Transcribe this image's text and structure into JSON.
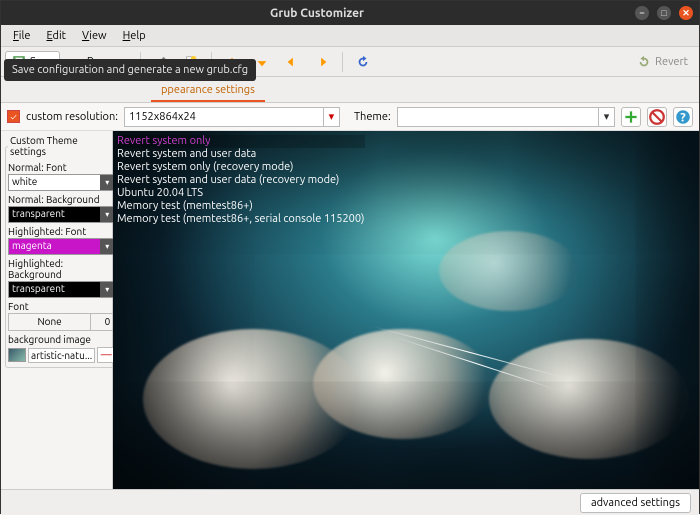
{
  "window": {
    "title": "Grub Customizer"
  },
  "menu": {
    "file": "File",
    "edit": "Edit",
    "view": "View",
    "help": "Help"
  },
  "toolbar": {
    "save": "Save",
    "remove": "Remove",
    "revert": "Revert",
    "tooltip": "Save configuration and generate a new grub.cfg"
  },
  "tabs": {
    "appearance": "ppearance settings"
  },
  "resolution": {
    "checkbox_label": "custom resolution:",
    "value": "1152x864x24",
    "theme_label": "Theme:",
    "theme_value": ""
  },
  "side": {
    "legend": "Custom Theme settings",
    "normal_font_label": "Normal: Font",
    "normal_font_value": "white",
    "normal_bg_label": "Normal: Background",
    "normal_bg_value": "transparent",
    "hl_font_label": "Highlighted: Font",
    "hl_font_value": "magenta",
    "hl_bg_label": "Highlighted: Background",
    "hl_bg_value": "transparent",
    "font_label": "Font",
    "font_name": "None",
    "font_size": "0",
    "bg_label": "background image",
    "bg_file": "artistic-natu..."
  },
  "grub": {
    "l0": "Revert system only",
    "l1": "Revert system and user data",
    "l2": "Revert system only (recovery mode)",
    "l3": "Revert system and user data (recovery mode)",
    "l4": "Ubuntu 20.04 LTS",
    "l5": "Memory test (memtest86+)",
    "l6": "Memory test (memtest86+, serial console 115200)"
  },
  "footer": {
    "advanced": "advanced settings"
  }
}
